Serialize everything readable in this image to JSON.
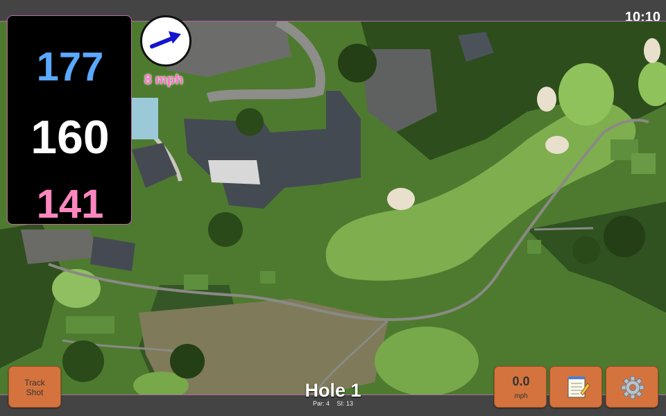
{
  "status": {
    "clock": "10:10"
  },
  "distances": {
    "back": "177",
    "middle": "160",
    "front": "141"
  },
  "wind": {
    "speed_label": "8 mph",
    "direction_icon": "arrow-icon"
  },
  "hole": {
    "title": "Hole 1",
    "par_label": "Par: 4",
    "si_label": "SI: 13"
  },
  "buttons": {
    "track_shot_line1": "Track",
    "track_shot_line2": "Shot",
    "speed_value": "0.0",
    "speed_unit": "mph",
    "notes_icon": "notepad-icon",
    "settings_icon": "gear-icon"
  },
  "colors": {
    "back_distance": "#5aa8ff",
    "middle_distance": "#ffffff",
    "front_distance": "#ff87bf",
    "button": "#d4733e",
    "wind_label": "#ff6fc4"
  }
}
